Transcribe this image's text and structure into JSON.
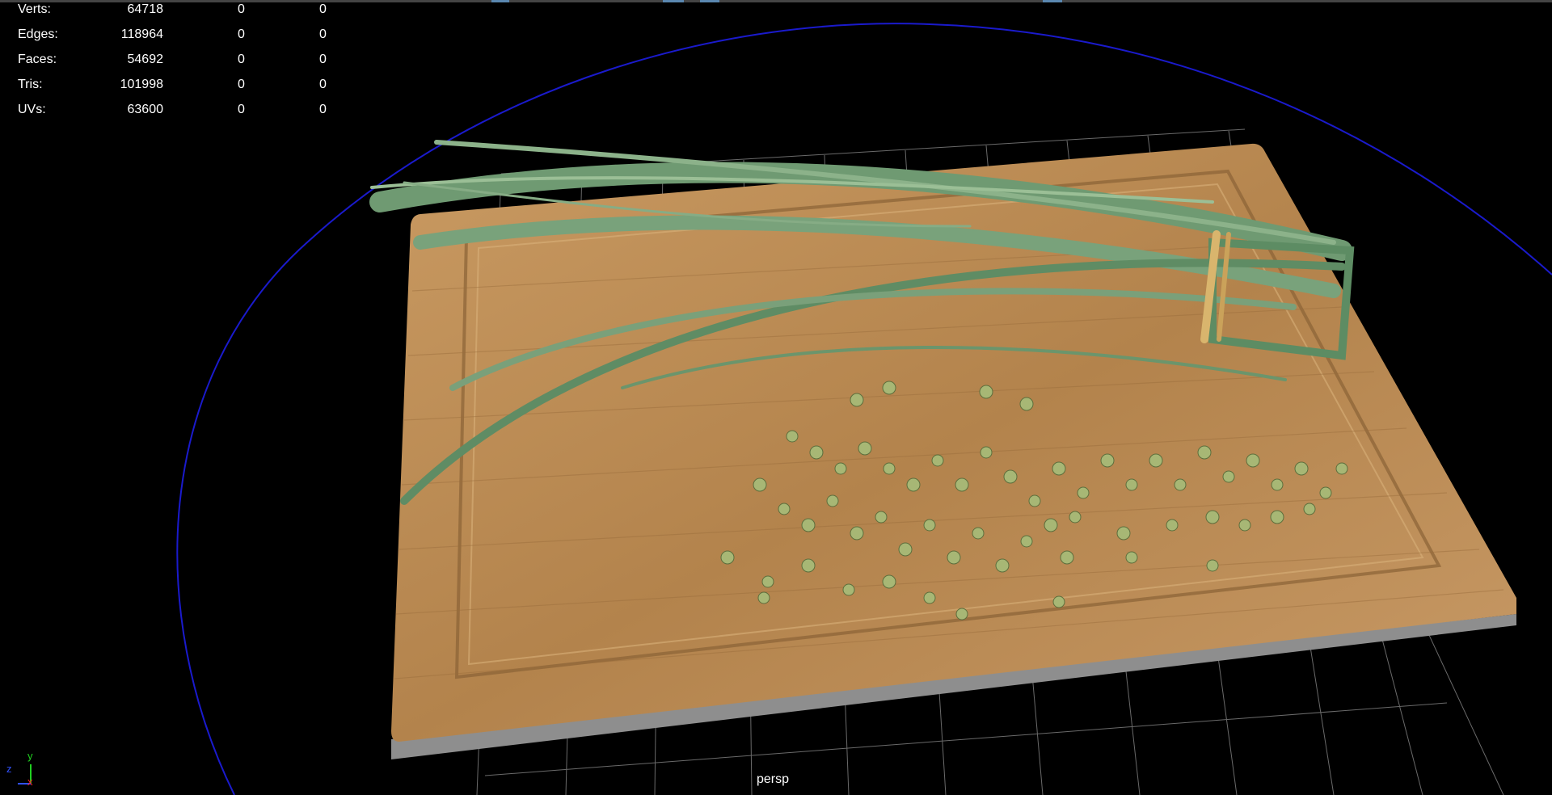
{
  "hud": {
    "rows": [
      {
        "label": "Verts:",
        "value": "64718",
        "selected": "0",
        "component": "0"
      },
      {
        "label": "Edges:",
        "value": "118964",
        "selected": "0",
        "component": "0"
      },
      {
        "label": "Faces:",
        "value": "54692",
        "selected": "0",
        "component": "0"
      },
      {
        "label": "Tris:",
        "value": "101998",
        "selected": "0",
        "component": "0"
      },
      {
        "label": "UVs:",
        "value": "63600",
        "selected": "0",
        "component": "0"
      }
    ]
  },
  "camera": {
    "name": "persp"
  },
  "axis": {
    "y": "y",
    "z": "z",
    "x": "x",
    "color_x": "#ff2020",
    "color_y": "#20d020",
    "color_z": "#3050ff"
  },
  "colors": {
    "background": "#000000",
    "grid": "#6a6a6a",
    "bounding_circle": "#1a1acc",
    "board": "#b58550",
    "scallions": "#6f9a72"
  }
}
